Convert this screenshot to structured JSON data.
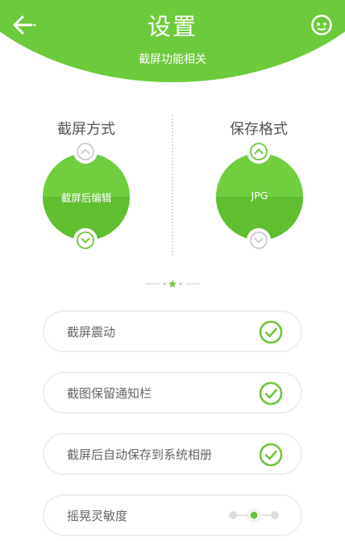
{
  "header": {
    "title": "设置",
    "subtitle": "截屏功能相关",
    "back_icon": "arrow-left-icon",
    "feedback_icon": "smiley-face-icon",
    "bg_color": "#6ccb3c"
  },
  "capture_mode": {
    "title": "截屏方式",
    "value": "截屏后编辑",
    "up_icon": "chevron-up-icon",
    "down_icon": "chevron-down-icon"
  },
  "save_format": {
    "title": "保存格式",
    "value": "JPG",
    "up_icon": "chevron-up-icon",
    "down_icon": "chevron-down-icon"
  },
  "pager": {
    "active_icon": "star-icon"
  },
  "options": [
    {
      "label": "截屏震动",
      "checked": true
    },
    {
      "label": "截图保留通知栏",
      "checked": true
    },
    {
      "label": "截屏后自动保存到系统相册",
      "checked": true
    },
    {
      "label": "摇晃灵敏度",
      "control": "slider",
      "level": 2,
      "levels": 3
    }
  ],
  "colors": {
    "accent": "#6ccb3c",
    "check": "#6fc43e",
    "inactive": "#cccccc"
  }
}
